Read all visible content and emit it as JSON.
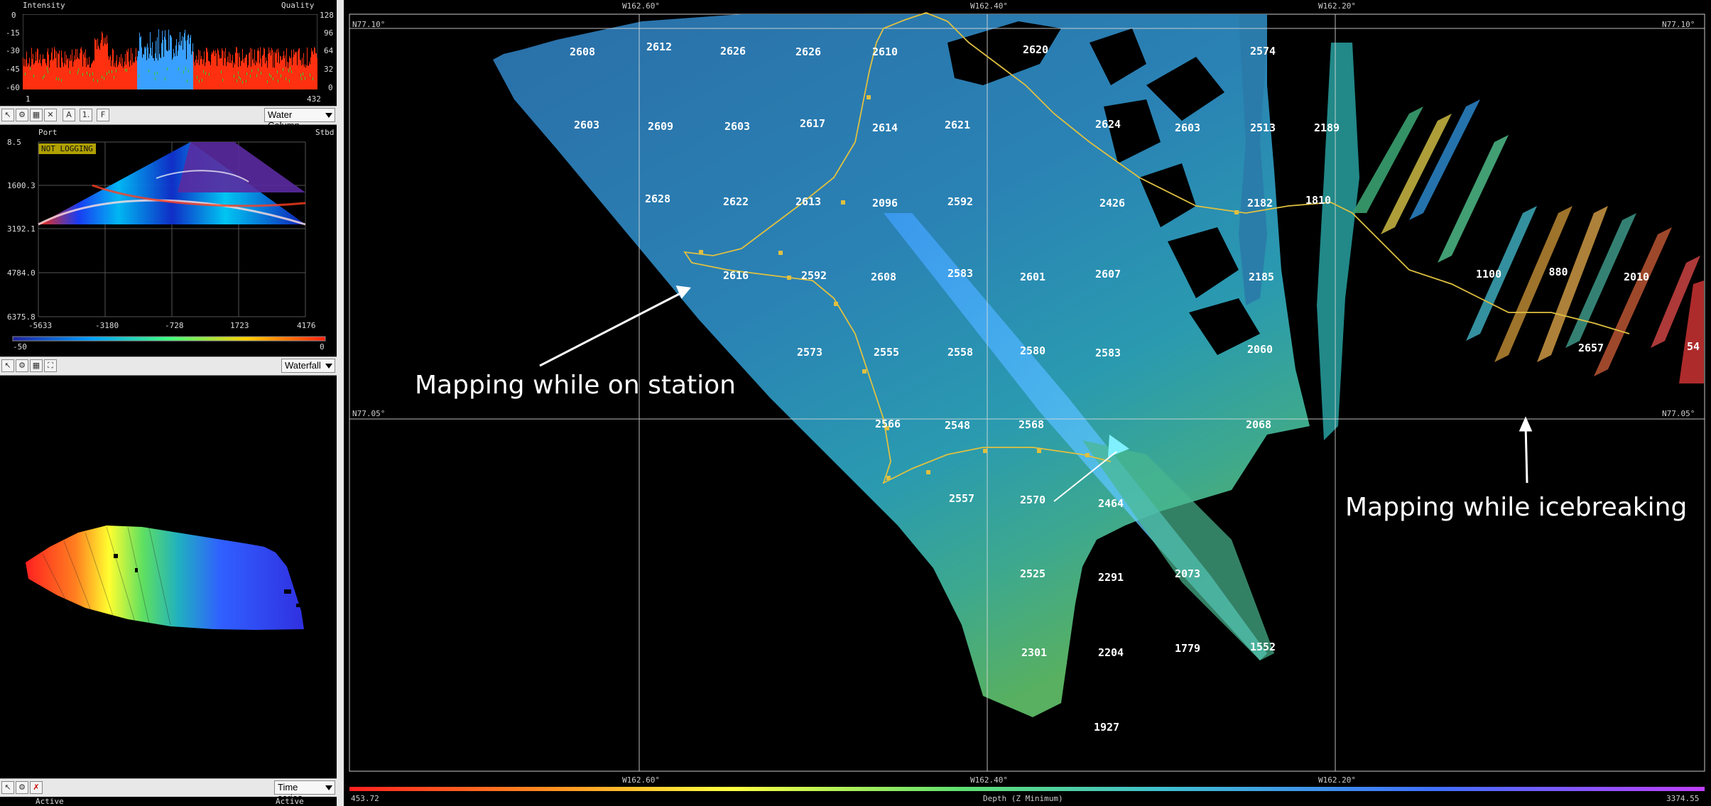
{
  "intensity_panel": {
    "left_title": "Intensity",
    "right_title": "Quality",
    "left_ticks": [
      "0",
      "-15",
      "-30",
      "-45",
      "-60"
    ],
    "right_ticks": [
      "128",
      "96",
      "64",
      "32",
      "0"
    ],
    "x_start": "1",
    "x_end": "432"
  },
  "water_column_toolbar": {
    "buttons": [
      "A",
      "1.",
      "F"
    ],
    "dropdown": "Water Column"
  },
  "water_column_panel": {
    "port_label": "Port",
    "stbd_label": "Stbd",
    "status_badge": "NOT LOGGING",
    "y_ticks": [
      "8.5",
      "1600.3",
      "3192.1",
      "4784.0",
      "6375.8"
    ],
    "x_ticks": [
      "-5633",
      "-3180",
      "-728",
      "1723",
      "4176"
    ],
    "scale_min": "-50",
    "scale_max": "0"
  },
  "waterfall_toolbar": {
    "dropdown": "Waterfall"
  },
  "timeseries_toolbar": {
    "dropdown": "Time series",
    "active_left": "Active",
    "active_right": "Active"
  },
  "map": {
    "top_coords": [
      "W162.60°",
      "W162.40°",
      "W162.20°"
    ],
    "bottom_coords": [
      "W162.60°",
      "W162.40°",
      "W162.20°"
    ],
    "lat_top_left": "N77.10°",
    "lat_top_right": "N77.10°",
    "lat_mid_left": "N77.05°",
    "lat_mid_right": "N77.05°",
    "colorbar_min": "453.72",
    "colorbar_label": "Depth (Z Minimum)",
    "colorbar_max": "3374.55",
    "annotation_station": "Mapping while on station",
    "annotation_icebreaking": "Mapping while icebreaking",
    "depths": [
      "2608",
      "2612",
      "2626",
      "2626",
      "2610",
      "2620",
      "2574",
      "2603",
      "2609",
      "2603",
      "2617",
      "2614",
      "2621",
      "2624",
      "2603",
      "2513",
      "2189",
      "2628",
      "2622",
      "2613",
      "2096",
      "2592",
      "2426",
      "2182",
      "1810",
      "2616",
      "2592",
      "2608",
      "2583",
      "2601",
      "2607",
      "2185",
      "1100",
      "880",
      "2010",
      "2573",
      "2555",
      "2558",
      "2580",
      "2583",
      "2060",
      "2657",
      "54",
      "2566",
      "2548",
      "2568",
      "2068",
      "2557",
      "2570",
      "2464",
      "2525",
      "2291",
      "2073",
      "2301",
      "2204",
      "1779",
      "1552",
      "1927"
    ]
  },
  "colors": {
    "toolbar_bg": "#e8e8e8",
    "track": "#e0c040",
    "grid": "#ffffff",
    "intensity_red": "#ff3010",
    "intensity_blue": "#3aa0ff"
  }
}
